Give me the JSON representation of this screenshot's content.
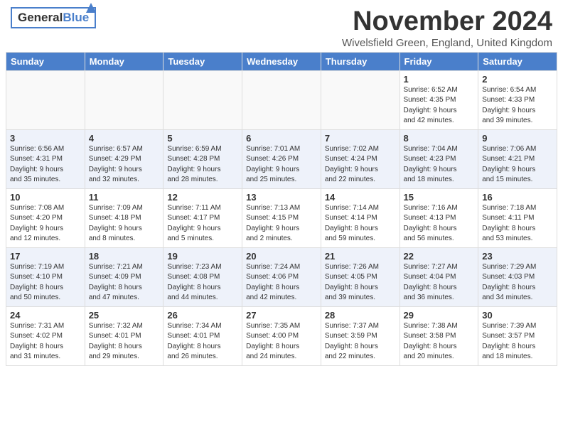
{
  "header": {
    "logo_general": "General",
    "logo_blue": "Blue",
    "month_title": "November 2024",
    "location": "Wivelsfield Green, England, United Kingdom"
  },
  "days_of_week": [
    "Sunday",
    "Monday",
    "Tuesday",
    "Wednesday",
    "Thursday",
    "Friday",
    "Saturday"
  ],
  "weeks": [
    {
      "days": [
        {
          "num": "",
          "info": "",
          "empty": true
        },
        {
          "num": "",
          "info": "",
          "empty": true
        },
        {
          "num": "",
          "info": "",
          "empty": true
        },
        {
          "num": "",
          "info": "",
          "empty": true
        },
        {
          "num": "",
          "info": "",
          "empty": true
        },
        {
          "num": "1",
          "info": "Sunrise: 6:52 AM\nSunset: 4:35 PM\nDaylight: 9 hours\nand 42 minutes."
        },
        {
          "num": "2",
          "info": "Sunrise: 6:54 AM\nSunset: 4:33 PM\nDaylight: 9 hours\nand 39 minutes."
        }
      ]
    },
    {
      "days": [
        {
          "num": "3",
          "info": "Sunrise: 6:56 AM\nSunset: 4:31 PM\nDaylight: 9 hours\nand 35 minutes."
        },
        {
          "num": "4",
          "info": "Sunrise: 6:57 AM\nSunset: 4:29 PM\nDaylight: 9 hours\nand 32 minutes."
        },
        {
          "num": "5",
          "info": "Sunrise: 6:59 AM\nSunset: 4:28 PM\nDaylight: 9 hours\nand 28 minutes."
        },
        {
          "num": "6",
          "info": "Sunrise: 7:01 AM\nSunset: 4:26 PM\nDaylight: 9 hours\nand 25 minutes."
        },
        {
          "num": "7",
          "info": "Sunrise: 7:02 AM\nSunset: 4:24 PM\nDaylight: 9 hours\nand 22 minutes."
        },
        {
          "num": "8",
          "info": "Sunrise: 7:04 AM\nSunset: 4:23 PM\nDaylight: 9 hours\nand 18 minutes."
        },
        {
          "num": "9",
          "info": "Sunrise: 7:06 AM\nSunset: 4:21 PM\nDaylight: 9 hours\nand 15 minutes."
        }
      ]
    },
    {
      "days": [
        {
          "num": "10",
          "info": "Sunrise: 7:08 AM\nSunset: 4:20 PM\nDaylight: 9 hours\nand 12 minutes."
        },
        {
          "num": "11",
          "info": "Sunrise: 7:09 AM\nSunset: 4:18 PM\nDaylight: 9 hours\nand 8 minutes."
        },
        {
          "num": "12",
          "info": "Sunrise: 7:11 AM\nSunset: 4:17 PM\nDaylight: 9 hours\nand 5 minutes."
        },
        {
          "num": "13",
          "info": "Sunrise: 7:13 AM\nSunset: 4:15 PM\nDaylight: 9 hours\nand 2 minutes."
        },
        {
          "num": "14",
          "info": "Sunrise: 7:14 AM\nSunset: 4:14 PM\nDaylight: 8 hours\nand 59 minutes."
        },
        {
          "num": "15",
          "info": "Sunrise: 7:16 AM\nSunset: 4:13 PM\nDaylight: 8 hours\nand 56 minutes."
        },
        {
          "num": "16",
          "info": "Sunrise: 7:18 AM\nSunset: 4:11 PM\nDaylight: 8 hours\nand 53 minutes."
        }
      ]
    },
    {
      "days": [
        {
          "num": "17",
          "info": "Sunrise: 7:19 AM\nSunset: 4:10 PM\nDaylight: 8 hours\nand 50 minutes."
        },
        {
          "num": "18",
          "info": "Sunrise: 7:21 AM\nSunset: 4:09 PM\nDaylight: 8 hours\nand 47 minutes."
        },
        {
          "num": "19",
          "info": "Sunrise: 7:23 AM\nSunset: 4:08 PM\nDaylight: 8 hours\nand 44 minutes."
        },
        {
          "num": "20",
          "info": "Sunrise: 7:24 AM\nSunset: 4:06 PM\nDaylight: 8 hours\nand 42 minutes."
        },
        {
          "num": "21",
          "info": "Sunrise: 7:26 AM\nSunset: 4:05 PM\nDaylight: 8 hours\nand 39 minutes."
        },
        {
          "num": "22",
          "info": "Sunrise: 7:27 AM\nSunset: 4:04 PM\nDaylight: 8 hours\nand 36 minutes."
        },
        {
          "num": "23",
          "info": "Sunrise: 7:29 AM\nSunset: 4:03 PM\nDaylight: 8 hours\nand 34 minutes."
        }
      ]
    },
    {
      "days": [
        {
          "num": "24",
          "info": "Sunrise: 7:31 AM\nSunset: 4:02 PM\nDaylight: 8 hours\nand 31 minutes."
        },
        {
          "num": "25",
          "info": "Sunrise: 7:32 AM\nSunset: 4:01 PM\nDaylight: 8 hours\nand 29 minutes."
        },
        {
          "num": "26",
          "info": "Sunrise: 7:34 AM\nSunset: 4:01 PM\nDaylight: 8 hours\nand 26 minutes."
        },
        {
          "num": "27",
          "info": "Sunrise: 7:35 AM\nSunset: 4:00 PM\nDaylight: 8 hours\nand 24 minutes."
        },
        {
          "num": "28",
          "info": "Sunrise: 7:37 AM\nSunset: 3:59 PM\nDaylight: 8 hours\nand 22 minutes."
        },
        {
          "num": "29",
          "info": "Sunrise: 7:38 AM\nSunset: 3:58 PM\nDaylight: 8 hours\nand 20 minutes."
        },
        {
          "num": "30",
          "info": "Sunrise: 7:39 AM\nSunset: 3:57 PM\nDaylight: 8 hours\nand 18 minutes."
        }
      ]
    }
  ]
}
